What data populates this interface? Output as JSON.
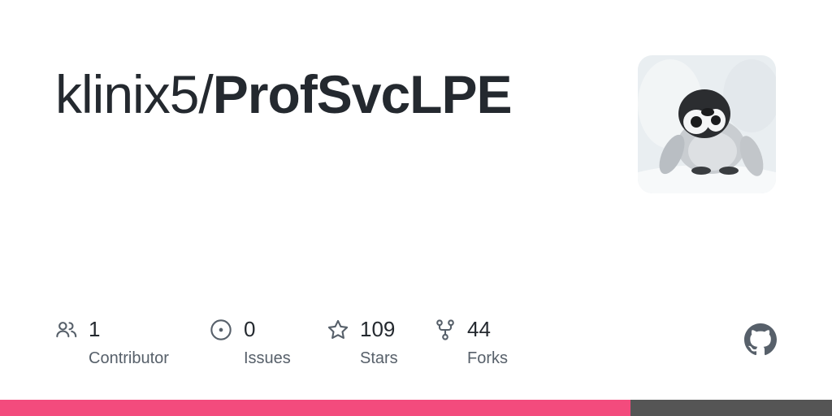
{
  "repo": {
    "owner": "klinix5/",
    "name": "ProfSvcLPE"
  },
  "avatar": {
    "icon": "penguin-avatar"
  },
  "stats": [
    {
      "icon": "people-icon",
      "value": "1",
      "label": "Contributor"
    },
    {
      "icon": "issue-opened-icon",
      "value": "0",
      "label": "Issues"
    },
    {
      "icon": "star-icon",
      "value": "109",
      "label": "Stars"
    },
    {
      "icon": "repo-forked-icon",
      "value": "44",
      "label": "Forks"
    }
  ],
  "brand_icon": "github-mark-icon",
  "language_bar": {
    "segments": [
      {
        "color": "#f34b7d",
        "fraction": 0.758
      },
      {
        "color": "#555555",
        "fraction": 0.242
      }
    ]
  },
  "colors": {
    "text": "#24292f",
    "muted": "#57606a",
    "icon": "#57606a"
  }
}
